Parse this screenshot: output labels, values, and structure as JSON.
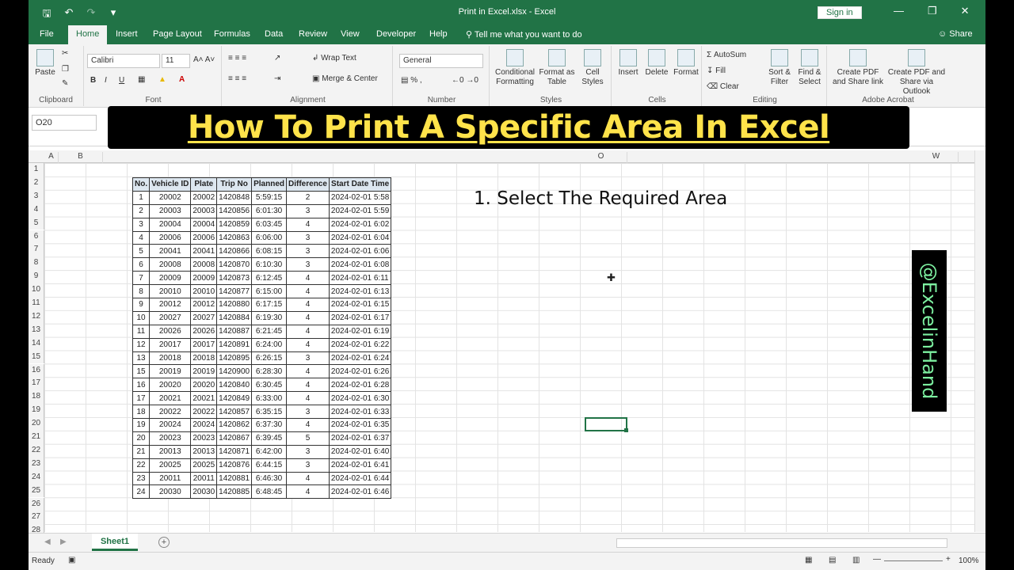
{
  "window": {
    "title": "Print in Excel.xlsx  -  Excel",
    "signin_label": "Sign in"
  },
  "menu": {
    "tabs": [
      "File",
      "Home",
      "Insert",
      "Page Layout",
      "Formulas",
      "Data",
      "Review",
      "View",
      "Developer",
      "Help"
    ],
    "active_tab": "Home",
    "tellme": "Tell me what you want to do",
    "share": "Share"
  },
  "ribbon": {
    "clipboard": {
      "label": "Clipboard",
      "paste": "Paste"
    },
    "font": {
      "label": "Font",
      "font_name": "Calibri",
      "font_size": "11"
    },
    "alignment": {
      "label": "Alignment",
      "wrap_text": "Wrap Text",
      "merge_center": "Merge & Center"
    },
    "number": {
      "label": "Number",
      "format": "General"
    },
    "styles": {
      "label": "Styles",
      "conditional": "Conditional Formatting",
      "format_table": "Format as Table",
      "cell_styles": "Cell Styles"
    },
    "cells": {
      "label": "Cells",
      "insert": "Insert",
      "delete": "Delete",
      "format": "Format"
    },
    "editing": {
      "label": "Editing",
      "autosum": "AutoSum",
      "fill": "Fill",
      "clear": "Clear",
      "sort_filter": "Sort & Filter",
      "find_select": "Find & Select"
    },
    "acrobat": {
      "label": "Adobe Acrobat",
      "create_pdf_link": "Create PDF and Share link",
      "create_pdf_outlook": "Create PDF and Share via Outlook"
    }
  },
  "namebox": "O20",
  "headline": "How To Print A Specific Area In Excel",
  "columns": [
    "A",
    "B",
    "",
    "",
    "",
    "",
    "",
    "",
    "",
    "",
    "",
    "",
    "",
    "",
    "O",
    "",
    "",
    "",
    "",
    "",
    "",
    "W"
  ],
  "rows": [
    "1",
    "2",
    "3",
    "4",
    "5",
    "6",
    "7",
    "8",
    "9",
    "10",
    "11",
    "12",
    "13",
    "14",
    "15",
    "16",
    "17",
    "18",
    "19",
    "20",
    "21",
    "22",
    "23",
    "24",
    "25",
    "26",
    "27",
    "28"
  ],
  "table": {
    "headers": [
      "No.",
      "Vehicle ID",
      "Plate",
      "Trip No",
      "Planned",
      "Difference",
      "Start Date Time"
    ],
    "rows": [
      [
        "1",
        "20002",
        "20002",
        "1420848",
        "5:59:15",
        "2",
        "2024-02-01 5:58"
      ],
      [
        "2",
        "20003",
        "20003",
        "1420856",
        "6:01:30",
        "3",
        "2024-02-01 5:59"
      ],
      [
        "3",
        "20004",
        "20004",
        "1420859",
        "6:03:45",
        "4",
        "2024-02-01 6:02"
      ],
      [
        "4",
        "20006",
        "20006",
        "1420863",
        "6:06:00",
        "3",
        "2024-02-01 6:04"
      ],
      [
        "5",
        "20041",
        "20041",
        "1420866",
        "6:08:15",
        "3",
        "2024-02-01 6:06"
      ],
      [
        "6",
        "20008",
        "20008",
        "1420870",
        "6:10:30",
        "3",
        "2024-02-01 6:08"
      ],
      [
        "7",
        "20009",
        "20009",
        "1420873",
        "6:12:45",
        "4",
        "2024-02-01 6:11"
      ],
      [
        "8",
        "20010",
        "20010",
        "1420877",
        "6:15:00",
        "4",
        "2024-02-01 6:13"
      ],
      [
        "9",
        "20012",
        "20012",
        "1420880",
        "6:17:15",
        "4",
        "2024-02-01 6:15"
      ],
      [
        "10",
        "20027",
        "20027",
        "1420884",
        "6:19:30",
        "4",
        "2024-02-01 6:17"
      ],
      [
        "11",
        "20026",
        "20026",
        "1420887",
        "6:21:45",
        "4",
        "2024-02-01 6:19"
      ],
      [
        "12",
        "20017",
        "20017",
        "1420891",
        "6:24:00",
        "4",
        "2024-02-01 6:22"
      ],
      [
        "13",
        "20018",
        "20018",
        "1420895",
        "6:26:15",
        "3",
        "2024-02-01 6:24"
      ],
      [
        "15",
        "20019",
        "20019",
        "1420900",
        "6:28:30",
        "4",
        "2024-02-01 6:26"
      ],
      [
        "16",
        "20020",
        "20020",
        "1420840",
        "6:30:45",
        "4",
        "2024-02-01 6:28"
      ],
      [
        "17",
        "20021",
        "20021",
        "1420849",
        "6:33:00",
        "4",
        "2024-02-01 6:30"
      ],
      [
        "18",
        "20022",
        "20022",
        "1420857",
        "6:35:15",
        "3",
        "2024-02-01 6:33"
      ],
      [
        "19",
        "20024",
        "20024",
        "1420862",
        "6:37:30",
        "4",
        "2024-02-01 6:35"
      ],
      [
        "20",
        "20023",
        "20023",
        "1420867",
        "6:39:45",
        "5",
        "2024-02-01 6:37"
      ],
      [
        "21",
        "20013",
        "20013",
        "1420871",
        "6:42:00",
        "3",
        "2024-02-01 6:40"
      ],
      [
        "22",
        "20025",
        "20025",
        "1420876",
        "6:44:15",
        "3",
        "2024-02-01 6:41"
      ],
      [
        "23",
        "20011",
        "20011",
        "1420881",
        "6:46:30",
        "4",
        "2024-02-01 6:44"
      ],
      [
        "24",
        "20030",
        "20030",
        "1420885",
        "6:48:45",
        "4",
        "2024-02-01 6:46"
      ]
    ]
  },
  "step_text": "1. Select The Required Area",
  "watermark": "@ExcelinHand",
  "sheet_tab": "Sheet1",
  "status": {
    "ready": "Ready",
    "zoom": "100%"
  }
}
